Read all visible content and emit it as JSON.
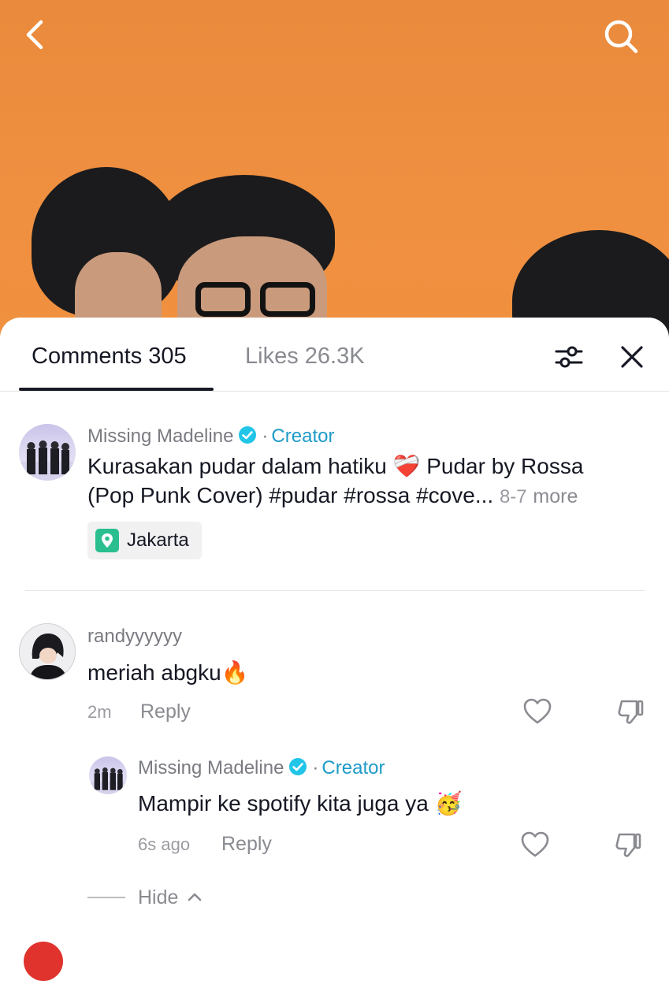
{
  "tabs": {
    "comments": "Comments 305",
    "likes": "Likes 26.3K"
  },
  "post": {
    "username": "Missing Madeline",
    "separator": "·",
    "badge": "Creator",
    "line1": "Kurasakan pudar dalam hatiku ❤️‍🩹 Pudar by Rossa",
    "line2": "(Pop Punk Cover) #pudar #rossa #cove...",
    "date": "8-7",
    "more": "more",
    "location": "Jakarta"
  },
  "comments": [
    {
      "username": "randyyyyyy",
      "text": "meriah abgku🔥",
      "time": "2m",
      "reply_label": "Reply"
    }
  ],
  "reply": {
    "username": "Missing Madeline",
    "separator": "·",
    "badge": "Creator",
    "text": "Mampir ke spotify kita juga ya 🥳",
    "time": "6s ago",
    "reply_label": "Reply"
  },
  "hide_label": "Hide",
  "colors": {
    "accent": "#1e9bc8",
    "verified": "#20c5e8",
    "video_bg": "#ef8f40",
    "location_pin": "#2bbf8f"
  },
  "icons": [
    "back-icon",
    "search-icon",
    "filter-icon",
    "close-icon",
    "verified-icon",
    "location-pin-icon",
    "heart-icon",
    "dislike-icon",
    "chevron-up-icon"
  ]
}
